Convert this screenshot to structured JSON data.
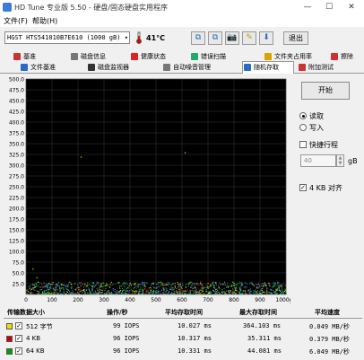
{
  "window": {
    "title": "HD Tune 专业版 5.50 - 硬盘/固态硬盘实用程序",
    "min": "—",
    "max": "☐",
    "close": "✕"
  },
  "menu": [
    "文件(F)",
    "帮助(H)"
  ],
  "toolbar": {
    "drive": "HGST HTS541010B7E610 (1000 gB)",
    "temperature": "41°C",
    "exit_label": "退出"
  },
  "tabs_row1": [
    "基准",
    "磁盘信息",
    "健康状态",
    "错误扫描",
    "文件夹占用率",
    "擦除"
  ],
  "tabs_row2": [
    "文件基准",
    "磁盘监视器",
    "自动噪音管理",
    "随机存取",
    "附加测试"
  ],
  "active_tab": "随机存取",
  "panel": {
    "start_label": "开始",
    "read_label": "读取",
    "write_label": "写入",
    "quick_label": "快捷行程",
    "quick_value": "40",
    "quick_unit": "gB",
    "align_label": "4 KB 对齐"
  },
  "chart_data": {
    "type": "scatter",
    "title": "",
    "xlabel": "",
    "ylabel": "ms",
    "xlim": [
      0,
      1000
    ],
    "ylim": [
      0,
      500
    ],
    "x_ticks": [
      "0",
      "100",
      "200",
      "300",
      "400",
      "500",
      "600",
      "700",
      "800",
      "900",
      "1000gB"
    ],
    "y_ticks": [
      "500.0",
      "475.0",
      "450.0",
      "425.0",
      "400.0",
      "375.0",
      "350.0",
      "325.0",
      "300.0",
      "275.0",
      "250.0",
      "225.0",
      "200.0",
      "175.0",
      "150.0",
      "125.0",
      "100.0",
      "75.0",
      "50.0",
      "25.0"
    ],
    "series": [
      {
        "name": "512 字节",
        "color": "#e8e000",
        "range_ms": [
          2,
          30
        ]
      },
      {
        "name": "4 KB",
        "color": "#d00000",
        "range_ms": [
          2,
          30
        ]
      },
      {
        "name": "64 KB",
        "color": "#00a000",
        "range_ms": [
          2,
          30
        ]
      },
      {
        "color": "#4080ff",
        "range_ms": [
          2,
          30
        ]
      },
      {
        "color": "#20c0c0",
        "range_ms": [
          2,
          30
        ]
      }
    ]
  },
  "results": {
    "headers": [
      "传输数据大小",
      "操作/秒",
      "平均存取时间",
      "最大存取时间",
      "平均速度"
    ],
    "rows": [
      {
        "size": "512 字节",
        "ops": "99 IOPS",
        "avg": "10.027 ms",
        "max": "364.103 ms",
        "speed": "0.049 MB/秒",
        "color": "#e8e000"
      },
      {
        "size": "4 KB",
        "ops": "96 IOPS",
        "avg": "10.317 ms",
        "max": "35.311 ms",
        "speed": "0.379 MB/秒",
        "color": "#d00000"
      },
      {
        "size": "64 KB",
        "ops": "96 IOPS",
        "avg": "10.331 ms",
        "max": "44.081 ms",
        "speed": "6.049 MB/秒",
        "color": "#00a000"
      }
    ]
  }
}
